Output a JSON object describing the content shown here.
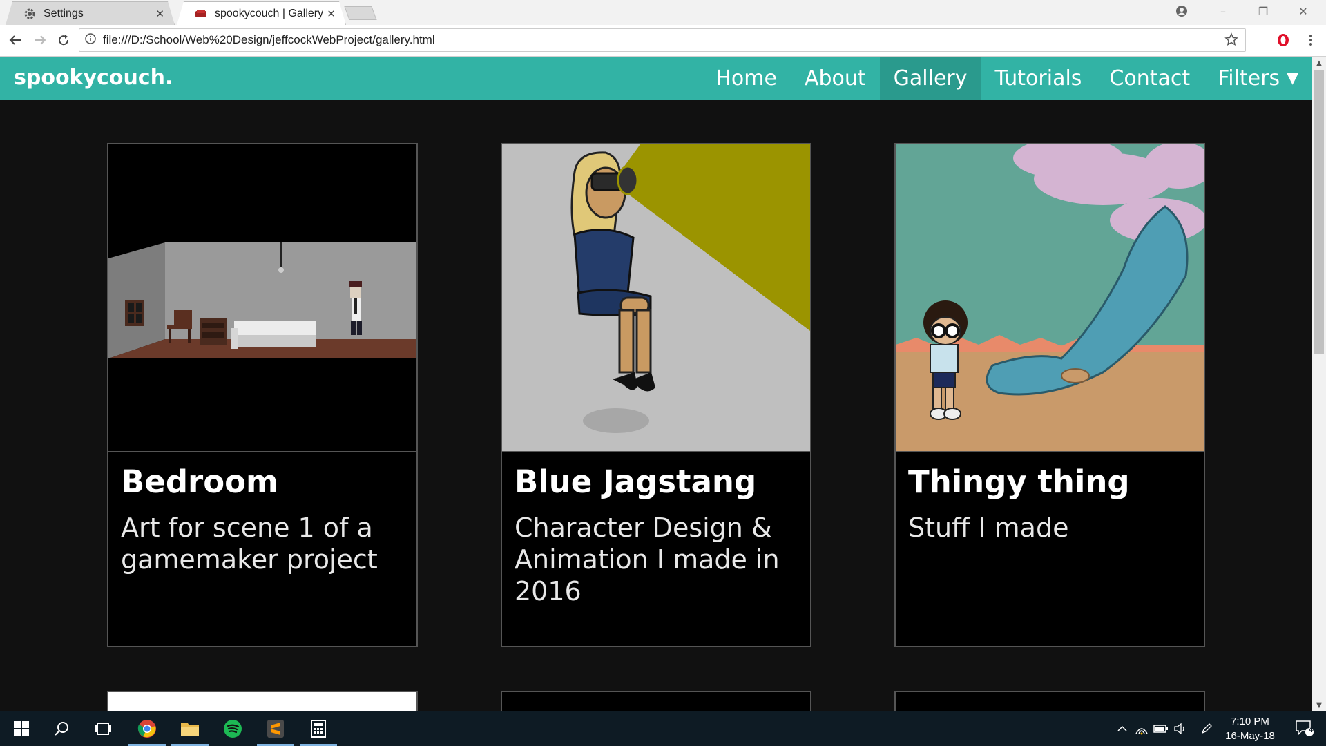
{
  "browser": {
    "tabs": [
      {
        "label": "Settings",
        "icon": "gear-icon"
      },
      {
        "label": "spookycouch | Gallery",
        "icon": "couch-icon"
      }
    ],
    "url": "file:///D:/School/Web%20Design/jeffcockWebProject/gallery.html"
  },
  "site": {
    "brand": "spookycouch.",
    "nav": [
      {
        "label": "Home"
      },
      {
        "label": "About"
      },
      {
        "label": "Gallery"
      },
      {
        "label": "Tutorials"
      },
      {
        "label": "Contact"
      },
      {
        "label": "Filters"
      }
    ],
    "active_nav": "Gallery",
    "accent_color": "#32b3a5"
  },
  "gallery": {
    "cards": [
      {
        "title": "Bedroom",
        "description": "Art for scene 1 of a gamemaker project"
      },
      {
        "title": "Blue Jagstang",
        "description": "Character Design & Animation I made in 2016"
      },
      {
        "title": "Thingy thing",
        "description": "Stuff I made"
      }
    ]
  },
  "taskbar": {
    "time": "7:10 PM",
    "date": "16-May-18",
    "notifications": "4"
  }
}
